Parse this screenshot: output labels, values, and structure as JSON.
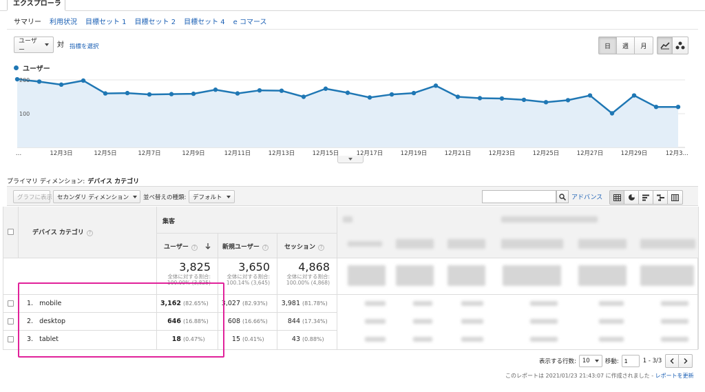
{
  "header": {
    "explorer_tab": "エクスプローラ"
  },
  "subtabs": [
    "サマリー",
    "利用状況",
    "目標セット 1",
    "目標セット 2",
    "目標セット 4",
    "e コマース"
  ],
  "metric_selector": {
    "value": "ユーザー",
    "vs_label": "対",
    "select_metric_link": "指標を選択"
  },
  "period_buttons": {
    "day": "日",
    "week": "週",
    "month": "月",
    "active": "日"
  },
  "legend": {
    "series_label": "ユーザー",
    "color": "#1f77b4"
  },
  "chart_data": {
    "type": "line",
    "series": [
      {
        "name": "ユーザー",
        "values": [
          202,
          195,
          186,
          198,
          160,
          161,
          157,
          158,
          159,
          171,
          160,
          169,
          168,
          150,
          174,
          162,
          148,
          157,
          161,
          183,
          150,
          146,
          145,
          141,
          134,
          140,
          154,
          101,
          154,
          120,
          120
        ]
      }
    ],
    "x_tick_labels": [
      "…",
      "12月3日",
      "12月5日",
      "12月7日",
      "12月9日",
      "12月11日",
      "12月13日",
      "12月15日",
      "12月17日",
      "12月19日",
      "12月21日",
      "12月23日",
      "12月25日",
      "12月27日",
      "12月29日",
      "12月3…"
    ],
    "y_tick_labels": [
      "200",
      "100"
    ],
    "ylim": [
      0,
      200
    ],
    "grid": true,
    "line_color": "#1f77b4",
    "fill_color": "#e3eef8"
  },
  "primary_dimension": {
    "label": "プライマリ ディメンション:",
    "value": "デバイス カテゴリ"
  },
  "toolbar": {
    "graph_button": "グラフに表示",
    "secondary_dimension": "セカンダリ ディメンション",
    "sort_label": "並べ替えの種類:",
    "sort_value": "デフォルト",
    "search_placeholder": "",
    "advanced_link": "アドバンス"
  },
  "table": {
    "dimension_header": "デバイス カテゴリ",
    "group_header": "集客",
    "columns": [
      "ユーザー",
      "新規ユーザー",
      "セッション"
    ],
    "totals": [
      {
        "value": "3,825",
        "sub1": "全体に対する割合:",
        "sub2": "100.00% (3,825)"
      },
      {
        "value": "3,650",
        "sub1": "全体に対する割合:",
        "sub2": "100.14% (3,645)"
      },
      {
        "value": "4,868",
        "sub1": "全体に対する割合:",
        "sub2": "100.00% (4,868)"
      }
    ],
    "rows": [
      {
        "index": "1.",
        "name": "mobile",
        "users": "3,162",
        "users_pct": "(82.65%)",
        "new_users": "3,027",
        "new_users_pct": "(82.93%)",
        "sessions": "3,981",
        "sessions_pct": "(81.78%)"
      },
      {
        "index": "2.",
        "name": "desktop",
        "users": "646",
        "users_pct": "(16.88%)",
        "new_users": "608",
        "new_users_pct": "(16.66%)",
        "sessions": "844",
        "sessions_pct": "(17.34%)"
      },
      {
        "index": "3.",
        "name": "tablet",
        "users": "18",
        "users_pct": "(0.47%)",
        "new_users": "15",
        "new_users_pct": "(0.41%)",
        "sessions": "43",
        "sessions_pct": "(0.88%)"
      }
    ]
  },
  "pagination": {
    "rows_label": "表示する行数:",
    "rows_value": "10",
    "goto_label": "移動:",
    "goto_value": "1",
    "range": "1 - 3/3"
  },
  "footer": {
    "note": "このレポートは 2021/01/23 21:43:07 に作成されました -",
    "refresh_link": "レポートを更新"
  },
  "highlight_color": "#e0219a"
}
